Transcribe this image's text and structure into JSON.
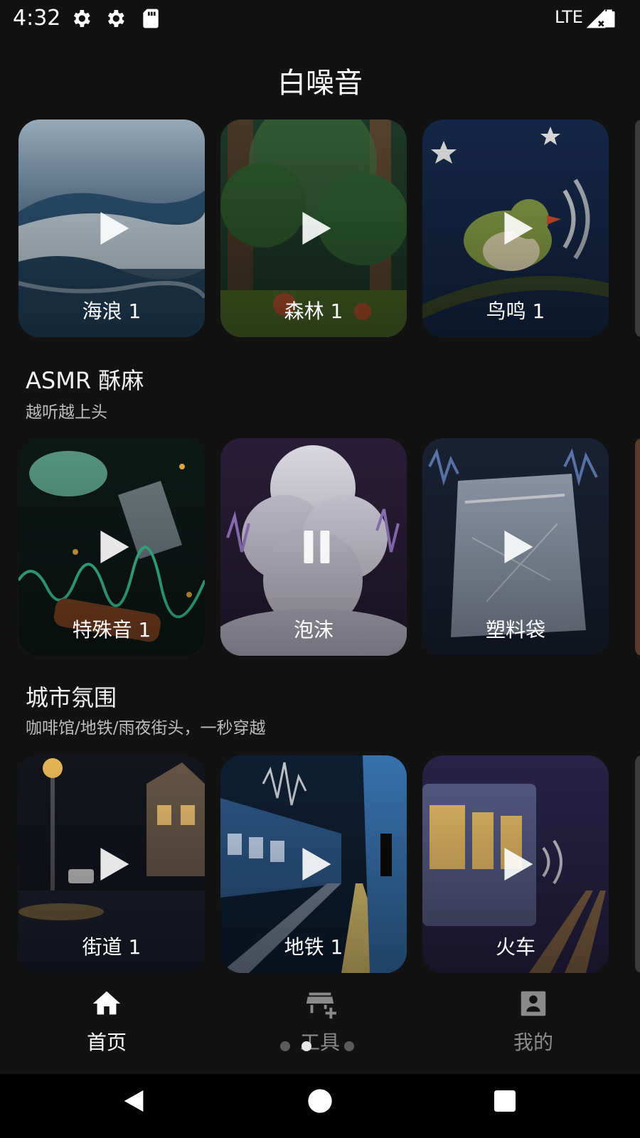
{
  "status_bar": {
    "time": "4:32",
    "network": "LTE",
    "icons": [
      "gear-icon",
      "gear-icon",
      "sd-card-icon",
      "signal-icon",
      "battery-icon"
    ]
  },
  "header": {
    "title": "白噪音"
  },
  "sections": [
    {
      "title": "",
      "subtitle": "",
      "cards": [
        {
          "label": "海浪 1",
          "state": "play",
          "icon": "play-icon"
        },
        {
          "label": "森林 1",
          "state": "play",
          "icon": "play-icon"
        },
        {
          "label": "鸟鸣 1",
          "state": "play",
          "icon": "play-icon"
        }
      ]
    },
    {
      "title": "ASMR 酥麻",
      "subtitle": "越听越上头",
      "cards": [
        {
          "label": "特殊音 1",
          "state": "play",
          "icon": "play-icon"
        },
        {
          "label": "泡沫",
          "state": "pause",
          "icon": "pause-icon"
        },
        {
          "label": "塑料袋",
          "state": "play",
          "icon": "play-icon"
        }
      ]
    },
    {
      "title": "城市氛围",
      "subtitle": "咖啡馆/地铁/雨夜街头，一秒穿越",
      "cards": [
        {
          "label": "街道 1",
          "state": "play",
          "icon": "play-icon"
        },
        {
          "label": "地铁 1",
          "state": "play",
          "icon": "play-icon"
        },
        {
          "label": "火车",
          "state": "play",
          "icon": "play-icon"
        }
      ]
    }
  ],
  "bottom_nav": {
    "items": [
      {
        "label": "首页",
        "icon": "home-icon",
        "active": true
      },
      {
        "label": "工具",
        "icon": "store-add-icon",
        "active": false
      },
      {
        "label": "我的",
        "icon": "account-box-icon",
        "active": false
      }
    ],
    "page_indicator": {
      "count": 3,
      "active_index": 1
    }
  },
  "system_nav": {
    "icons": [
      "back-icon",
      "home-circle-icon",
      "recents-icon"
    ]
  },
  "colors": {
    "background": "#121212",
    "active_nav": "#ffffff",
    "inactive_nav": "#8a8a8a",
    "subtitle": "#bdbdbd"
  }
}
